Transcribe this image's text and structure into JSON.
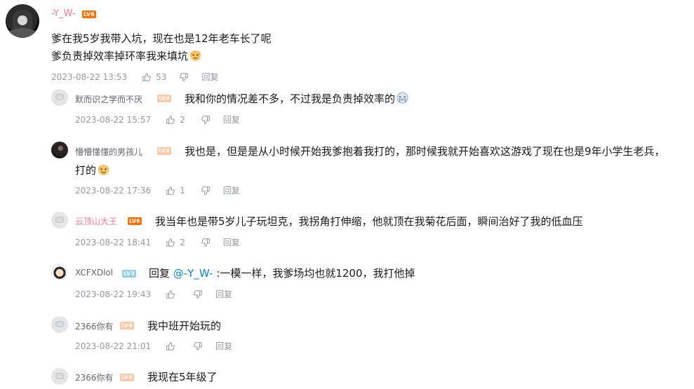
{
  "colors": {
    "vip_pink": "#fb7299",
    "meta_gray": "#9499a0",
    "link_blue": "#008ac5",
    "lv6": "#ff6c00",
    "lv4": "#ffc6a1",
    "lv3": "#8fcfec"
  },
  "main_comment": {
    "username": "-Y_W-",
    "level": "LV6",
    "lines": [
      "爹在我5岁我带入坑，现在也是12年老车长了呢",
      "爹负责掉效率掉环率我来填坑"
    ],
    "emoji": "cat-emoji",
    "time": "2023-08-22 13:53",
    "likes": "53",
    "reply_label": "回复"
  },
  "replies": [
    {
      "username": "默而识之学而不厌",
      "level": "LV4",
      "text": "我和你的情况差不多，不过我是负责掉效率的",
      "emoji": "crying-emoji",
      "time": "2023-08-22 15:57",
      "likes": "2",
      "reply_label": "回复"
    },
    {
      "username": "懵懵懂懂的男孩儿",
      "level": "LV4",
      "text": "我也是，但是是从小时候开始我爹抱着我打的，那时候我就开始喜欢这游戏了现在也是9年小学生老兵，",
      "text2": "打的",
      "emoji": "cat-emoji",
      "time": "2023-08-22 17:36",
      "likes": "1",
      "reply_label": "回复"
    },
    {
      "username": "云顶山大王",
      "level": "LV6",
      "text": "我当年也是带5岁儿子玩坦克，我拐角打伸缩，他就顶在我菊花后面，瞬间治好了我的低血压",
      "time": "2023-08-22 18:41",
      "likes": "2",
      "reply_label": "回复"
    },
    {
      "username": "XCFXDlol",
      "level": "LV3",
      "reply_word": "回复",
      "mention": "@-Y_W-",
      "text": " :一模一样，我爹场均也就1200，我打他掉",
      "time": "2023-08-22 19:43",
      "likes": "",
      "reply_label": "回复"
    },
    {
      "username": "2366你有",
      "level": "LV4",
      "text": "我中班开始玩的",
      "time": "2023-08-22 21:01",
      "likes": "",
      "reply_label": "回复"
    },
    {
      "username": "2366你有",
      "level": "LV4",
      "text": "我现在5年级了"
    }
  ]
}
